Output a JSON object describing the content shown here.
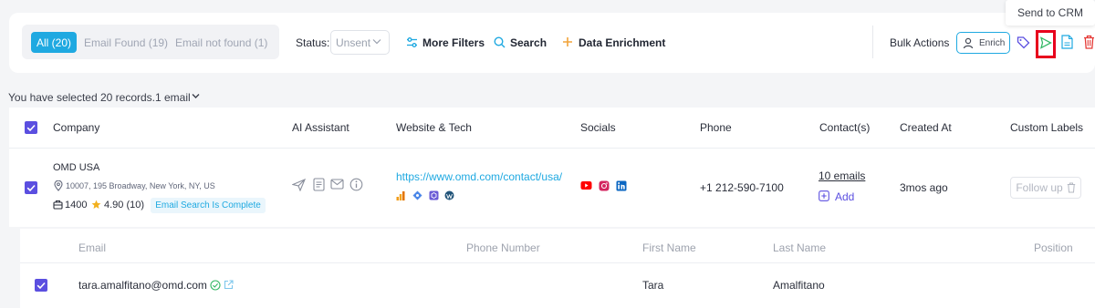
{
  "tooltip": "Send to CRM",
  "filters": {
    "tabs": [
      "All (20)",
      "Email Found (19)",
      "Email not found (1)"
    ],
    "status_label": "Status:",
    "status_value": "Unsent",
    "more_filters": "More Filters",
    "search": "Search",
    "data_enrichment": "Data Enrichment"
  },
  "bulk": {
    "label": "Bulk Actions",
    "enrich": "Enrich"
  },
  "selection": {
    "text": "You have selected 20 records.",
    "email_select": "1 email"
  },
  "table": {
    "headers": [
      "Company",
      "AI Assistant",
      "Website & Tech",
      "Socials",
      "Phone",
      "Contact(s)",
      "Created At",
      "Custom Labels"
    ],
    "row": {
      "company": "OMD USA",
      "address": "10007, 195 Broadway, New York, NY, US",
      "employees": "1400",
      "rating": "4.90 (10)",
      "badge": "Email Search Is Complete",
      "website": "https://www.omd.com/contact/usa/",
      "phone": "+1 212-590-7100",
      "emails": "10 emails",
      "add": "Add",
      "created": "3mos ago",
      "label_button": "Follow up"
    }
  },
  "contacts": {
    "headers": [
      "Email",
      "Phone Number",
      "First Name",
      "Last Name",
      "Position"
    ],
    "row": {
      "email": "tara.amalfitano@omd.com",
      "phone": "",
      "first_name": "Tara",
      "last_name": "Amalfitano",
      "position": ""
    }
  },
  "colors": {
    "accent": "#1fa9e1",
    "checkbox": "#5b4fe0",
    "danger": "#e8001c"
  }
}
